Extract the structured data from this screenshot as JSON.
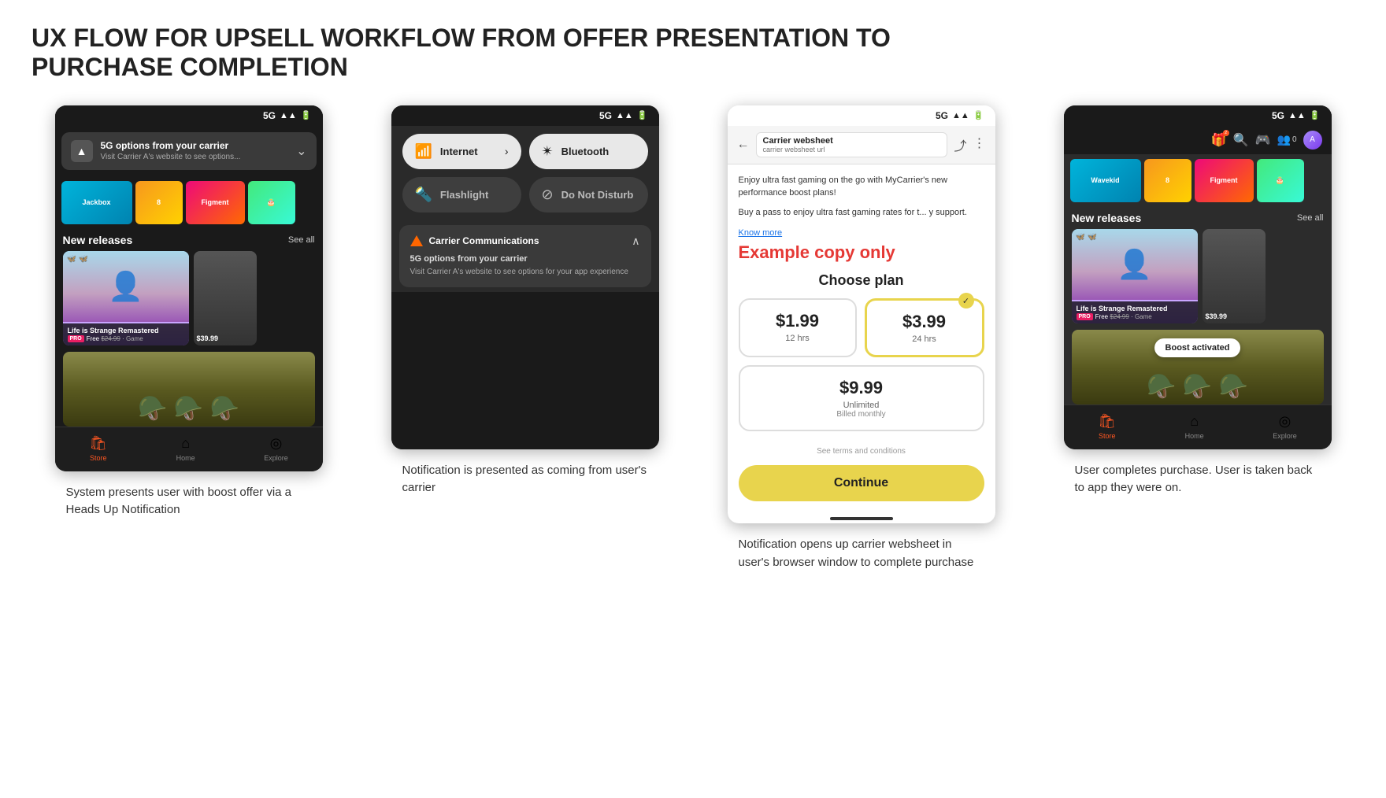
{
  "page": {
    "title": "UX FLOW FOR UPSELL WORKFLOW FROM OFFER PRESENTATION TO PURCHASE COMPLETION"
  },
  "screen1": {
    "status_bar": "5G",
    "notification": {
      "title": "5G options from your carrier",
      "subtitle": "Visit Carrier A's website to see options..."
    },
    "section_title": "New releases",
    "see_all": "See all",
    "game1": {
      "title": "Life is Strange Remastered",
      "badge": "PRO",
      "price": "Free",
      "old_price": "$24.99",
      "type": "Game"
    },
    "game2": {
      "price": "$39.99"
    },
    "nav": {
      "store": "Store",
      "home": "Home",
      "explore": "Explore"
    },
    "description": "System presents user with boost offer via a Heads Up Notification"
  },
  "screen2": {
    "status_bar": "5G",
    "tiles": [
      {
        "label": "Internet",
        "active": true
      },
      {
        "label": "Bluetooth",
        "active": true
      },
      {
        "label": "Flashlight",
        "active": false
      },
      {
        "label": "Do Not Disturb",
        "active": false
      }
    ],
    "notification": {
      "source": "Carrier Communications",
      "title": "5G options from your carrier",
      "body": "Visit Carrier A's website to see options for your app experience"
    },
    "description": "Notification is presented as coming from user's carrier"
  },
  "screen3": {
    "status_bar": "5G",
    "toolbar": {
      "title": "Carrier websheet",
      "url": "carrier websheet url"
    },
    "promo_text": "Enjoy ultra fast gaming on the go with MyCarrier's new performance boost plans!",
    "promo_sub": "Buy a pass to enjoy ultra fast gaming rates for t... y support.",
    "know_more": "Know more",
    "example_copy": "Example copy only",
    "choose_plan_title": "Choose plan",
    "plans": [
      {
        "price": "$1.99",
        "duration": "12 hrs"
      },
      {
        "price": "$3.99",
        "duration": "24 hrs",
        "selected": true
      },
      {
        "price": "$9.99",
        "duration": "Unlimited",
        "billing": "Billed monthly"
      }
    ],
    "terms": "See terms and conditions",
    "continue_btn": "Continue",
    "description": "Notification opens up carrier websheet in user's browser window to complete purchase"
  },
  "screen4": {
    "status_bar": "5G",
    "section_title": "New releases",
    "see_all": "See all",
    "game1": {
      "title": "Life is Strange Remastered",
      "badge": "PRO",
      "price": "Free",
      "old_price": "$24.99",
      "type": "Game"
    },
    "game2": {
      "price": "$39.99"
    },
    "boost_badge": "Boost activated",
    "nav": {
      "store": "Store",
      "home": "Home",
      "explore": "Explore"
    },
    "description": "User completes purchase. User is taken back to app they were on."
  }
}
